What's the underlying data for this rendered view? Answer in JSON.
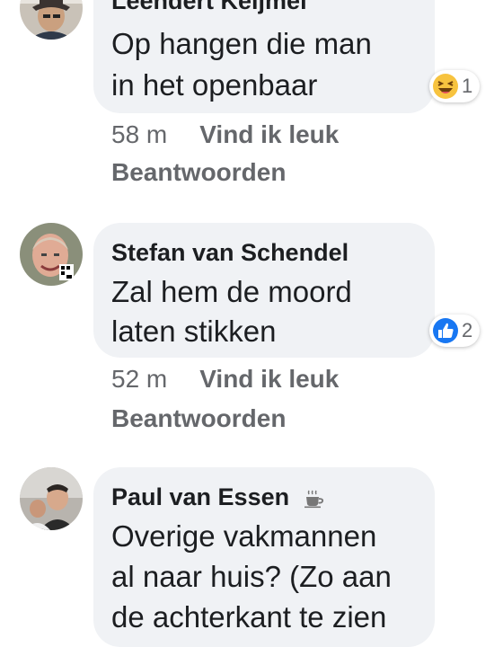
{
  "comments": [
    {
      "author": "Leendert Keijmel",
      "lines": [
        "Op hangen die man",
        "in het openbaar"
      ],
      "reaction": {
        "icon": "haha-emoji-icon",
        "count": "1"
      },
      "time": "58 m",
      "like": "Vind ik leuk",
      "reply": "Beantwoorden"
    },
    {
      "author": "Stefan van Schendel",
      "lines": [
        "Zal hem de moord",
        "laten stikken"
      ],
      "reaction": {
        "icon": "like-thumb-icon",
        "count": "2"
      },
      "time": "52 m",
      "like": "Vind ik leuk",
      "reply": "Beantwoorden"
    },
    {
      "author": "Paul van Essen",
      "author_badge": "coffee-cup-icon",
      "lines": [
        "Overige vakmannen",
        "al naar huis? (Zo aan",
        "de achterkant te zien"
      ]
    }
  ],
  "colors": {
    "bubble": "#f0f2f5",
    "meta_text": "#65676b",
    "like_blue": "#1877f2",
    "haha_yellow": "#f7c33f"
  }
}
